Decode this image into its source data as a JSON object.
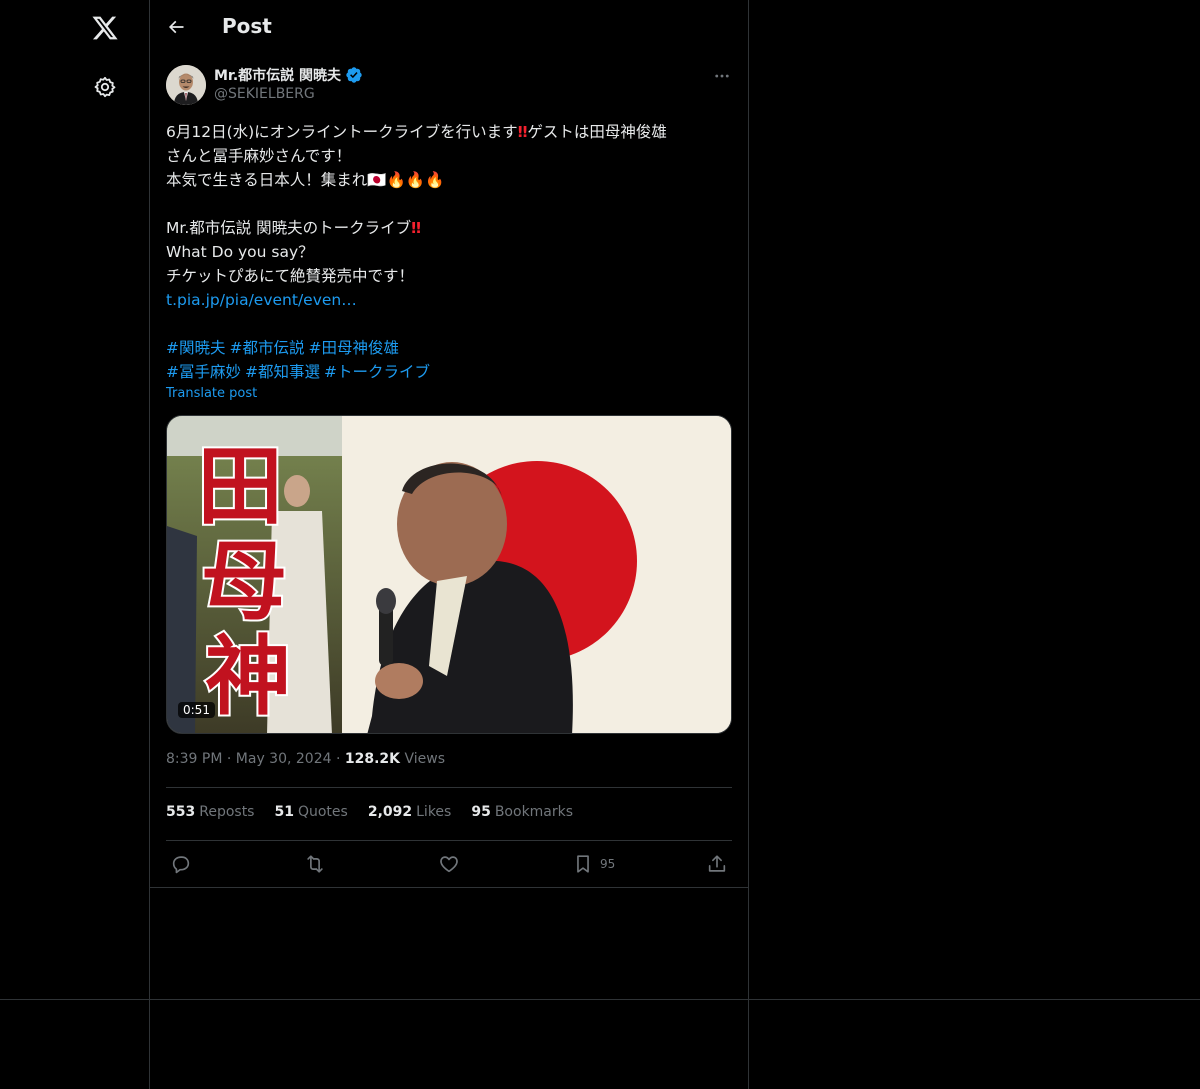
{
  "header": {
    "title": "Post"
  },
  "author": {
    "name": "Mr.都市伝説 関暁夫",
    "handle": "@SEKIELBERG"
  },
  "post": {
    "line1": "6月12日(水)にオンライントークライブを行います",
    "line1_bang": "‼",
    "line1_tail": "ゲストは田母神俊雄",
    "line2": "さんと冨手麻妙さんです！",
    "line3": "本気で生きる日本人！集まれ",
    "line3_emoji": "🇯🇵🔥🔥🔥",
    "line4": "Mr.都市伝説 関暁夫のトークライブ",
    "line4_bang": "‼",
    "line5": "What Do you say？",
    "line6": "チケットぴあにて絶賛発売中です！",
    "link": "t.pia.jp/pia/event/even…",
    "hashtags_row1": [
      "#関暁夫",
      "#都市伝説",
      "#田母神俊雄"
    ],
    "hashtags_row2": [
      "#冨手麻妙",
      "#都知事選",
      "#トークライブ"
    ],
    "translate": "Translate post"
  },
  "media": {
    "duration": "0:51",
    "overlay_text": [
      "田",
      "母",
      "神"
    ]
  },
  "meta": {
    "time": "8:39 PM",
    "date": "May 30, 2024",
    "views_count": "128.2K",
    "views_label": "Views"
  },
  "stats": {
    "reposts_count": "553",
    "reposts_label": "Reposts",
    "quotes_count": "51",
    "quotes_label": "Quotes",
    "likes_count": "2,092",
    "likes_label": "Likes",
    "bookmarks_count": "95",
    "bookmarks_label": "Bookmarks"
  },
  "actions": {
    "bookmark_count": "95"
  },
  "icons": {
    "logo": "x-logo-icon",
    "settings": "gear-icon",
    "back": "arrow-left-icon",
    "verified": "verified-badge-icon",
    "more": "more-horizontal-icon",
    "reply": "reply-icon",
    "repost": "repost-icon",
    "like": "heart-icon",
    "bookmark": "bookmark-icon",
    "share": "share-icon"
  },
  "colors": {
    "background": "#000000",
    "text": "#e7e9ea",
    "muted": "#71767b",
    "accent": "#1d9bf0",
    "border": "#2f3336",
    "alert": "#f4212e"
  }
}
